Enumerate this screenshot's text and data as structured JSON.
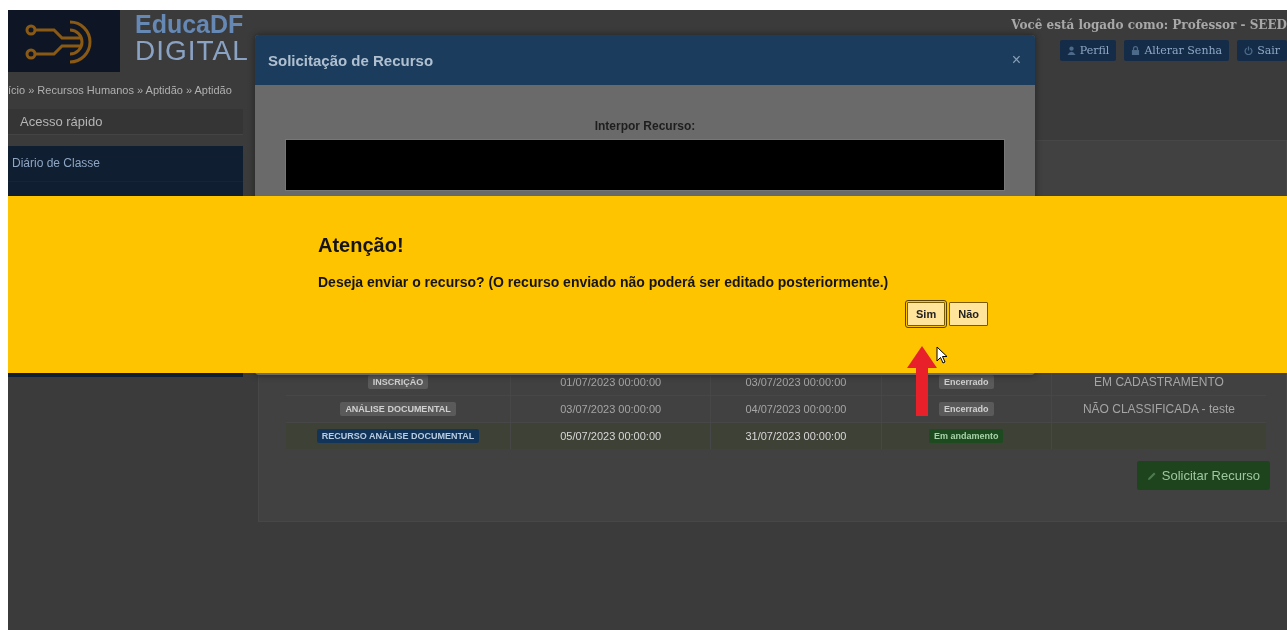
{
  "header": {
    "logo_line1": "EducaDF",
    "logo_line2": "DIGITAL",
    "login_text": "Você está logado como: Professor - SEED",
    "buttons": [
      {
        "label": "Perfil",
        "kind": "user"
      },
      {
        "label": "Alterar Senha",
        "kind": "lock"
      },
      {
        "label": "Sair",
        "kind": "power"
      }
    ]
  },
  "breadcrumb": "ício » Recursos Humanos » Aptidão » Aptidão",
  "sidebar": {
    "search": {
      "placeholder": "Acesso rápido"
    },
    "items": [
      {
        "label": "Diário de Classe"
      }
    ]
  },
  "table": {
    "rows": [
      {
        "stage": "INSCRIÇÃO",
        "start": "01/07/2023 00:00:00",
        "end": "03/07/2023 00:00:00",
        "status": "Encerrado",
        "result": "EM CADASTRAMENTO",
        "selected": false
      },
      {
        "stage": "ANÁLISE DOCUMENTAL",
        "start": "03/07/2023 00:00:00",
        "end": "04/07/2023 00:00:00",
        "status": "Encerrado",
        "result": "NÃO CLASSIFICADA - teste",
        "selected": false
      },
      {
        "stage": "RECURSO ANÁLISE DOCUMENTAL",
        "start": "05/07/2023 00:00:00",
        "end": "31/07/2023 00:00:00",
        "status": "Em andamento",
        "selected": true
      }
    ]
  },
  "request_button": "Solicitar Recurso",
  "modal": {
    "title": "Solicitação de Recurso",
    "close": "×",
    "field_label": "Interpor Recurso:"
  },
  "alert": {
    "title": "Atenção!",
    "message": "Deseja enviar o recurso? (O recurso enviado não poderá ser editado posteriormente.)",
    "buttons": [
      {
        "label": "Sim",
        "selected": true
      },
      {
        "label": "Não",
        "selected": false
      }
    ]
  }
}
